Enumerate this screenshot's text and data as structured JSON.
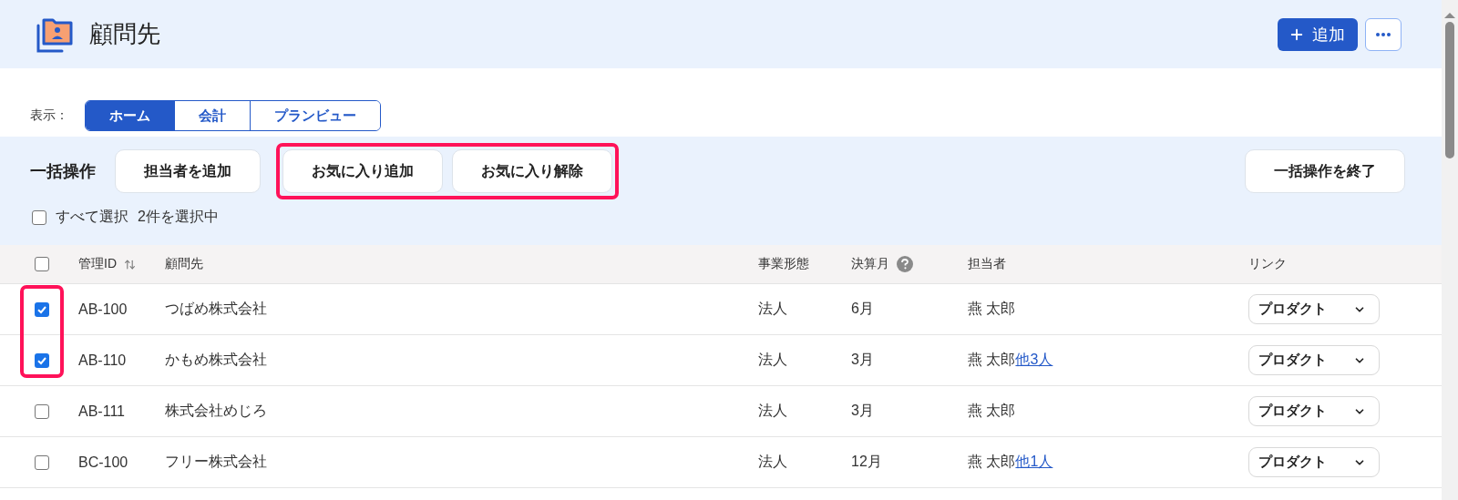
{
  "page": {
    "title": "顧問先"
  },
  "header_actions": {
    "add_label": "追加"
  },
  "view_switch": {
    "label": "表示：",
    "tabs": [
      {
        "label": "ホーム",
        "selected": true
      },
      {
        "label": "会計",
        "selected": false
      },
      {
        "label": "プランビュー",
        "selected": false
      }
    ]
  },
  "bulk_actions": {
    "title": "一括操作",
    "buttons": [
      {
        "label": "担当者を追加",
        "highlighted": false
      },
      {
        "label": "お気に入り追加",
        "highlighted": true
      },
      {
        "label": "お気に入り解除",
        "highlighted": true
      }
    ],
    "end_button": "一括操作を終了",
    "select_all": {
      "label": "すべて選択",
      "checked": false
    },
    "selection_count": "2件を選択中"
  },
  "table": {
    "header_checked": false,
    "columns": [
      {
        "label": "管理ID",
        "kind": "sortable"
      },
      {
        "label": "顧問先",
        "kind": "plain"
      },
      {
        "label": "事業形態",
        "kind": "plain"
      },
      {
        "label": "決算月",
        "kind": "help"
      },
      {
        "label": "担当者",
        "kind": "plain"
      },
      {
        "label": "リンク",
        "kind": "plain"
      }
    ],
    "rows": [
      {
        "checked": true,
        "highlighted": true,
        "id": "AB-100",
        "name": "つばめ株式会社",
        "entity": "法人",
        "fiscal_month": "6月",
        "staff": "燕 太郎",
        "link_menu": "プロダクト"
      },
      {
        "checked": true,
        "highlighted": true,
        "id": "AB-110",
        "name": "かもめ株式会社",
        "entity": "法人",
        "fiscal_month": "3月",
        "staff": "燕 太郎",
        "staff_more": "他3人",
        "link_menu": "プロダクト"
      },
      {
        "checked": false,
        "highlighted": false,
        "id": "AB-111",
        "name": "株式会社めじろ",
        "entity": "法人",
        "fiscal_month": "3月",
        "staff": "燕 太郎",
        "link_menu": "プロダクト"
      },
      {
        "checked": false,
        "highlighted": false,
        "id": "BC-100",
        "name": "フリー株式会社",
        "entity": "法人",
        "fiscal_month": "12月",
        "staff": "燕 太郎",
        "staff_more": "他1人",
        "link_menu": "プロダクト"
      }
    ]
  }
}
